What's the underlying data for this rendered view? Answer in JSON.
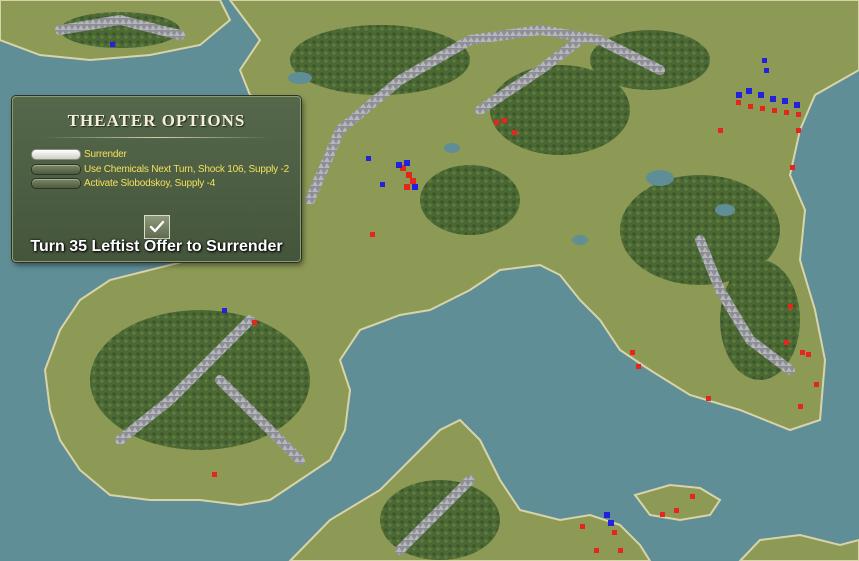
{
  "map": {
    "sea_color": "#5f8e96",
    "land_color": "#8d9a56",
    "forest_color": "#3e5e2e",
    "mountain_color": "#9a9aa0",
    "shore_color": "#d9d3a8",
    "red_units_color": "#e5261c",
    "blue_units_color": "#2222dd"
  },
  "panel": {
    "title": "THEATER OPTIONS",
    "options": [
      {
        "label": "Surrender",
        "selected": true
      },
      {
        "label": "Use Chemicals Next Turn, Shock 106, Supply -2",
        "selected": false
      },
      {
        "label": "Activate Slobodskoy, Supply -4",
        "selected": false
      }
    ],
    "confirm_icon": "checkmark-icon",
    "turn_message": "Turn 35 Leftist Offer to Surrender"
  }
}
